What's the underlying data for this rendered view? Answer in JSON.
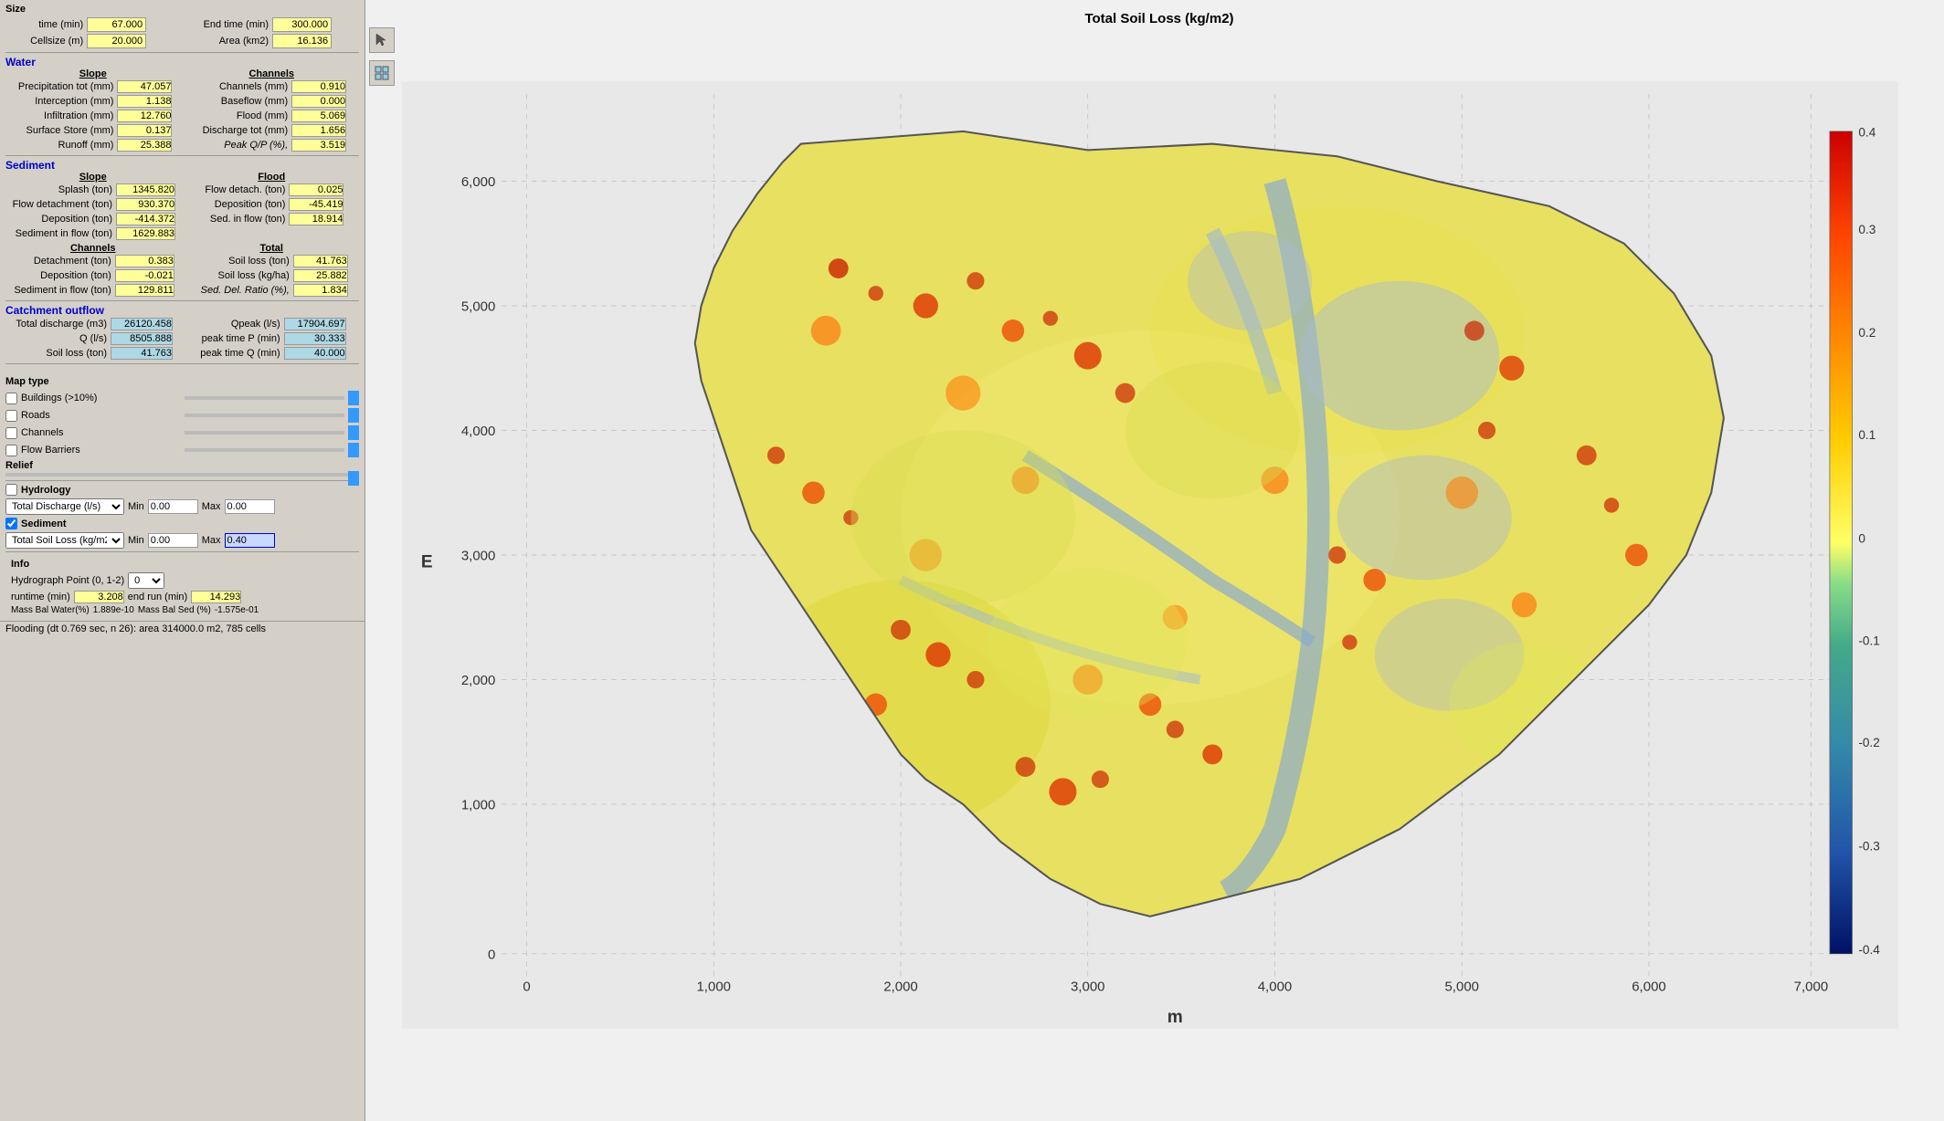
{
  "leftPanel": {
    "size": {
      "title": "Size",
      "time_label": "time (min)",
      "time_val": "67.000",
      "end_time_label": "End time (min)",
      "end_time_val": "300.000",
      "cellsize_label": "Cellsize (m)",
      "cellsize_val": "20.000",
      "area_label": "Area (km2)",
      "area_val": "16.136"
    },
    "water": {
      "title": "Water",
      "slope_header": "Slope",
      "channels_header": "Channels",
      "precip_label": "Precipitation tot (mm)",
      "precip_val": "47.057",
      "channels_mm_label": "Channels (mm)",
      "channels_mm_val": "0.910",
      "interception_label": "Interception (mm)",
      "interception_val": "1.138",
      "baseflow_label": "Baseflow (mm)",
      "baseflow_val": "0.000",
      "infiltration_label": "Infiltration (mm)",
      "infiltration_val": "12.760",
      "flood_label": "Flood (mm)",
      "flood_val": "5.069",
      "surface_label": "Surface Store (mm)",
      "surface_val": "0.137",
      "discharge_label": "Discharge tot (mm)",
      "discharge_val": "1.656",
      "runoff_label": "Runoff (mm)",
      "runoff_val": "25.388",
      "peakqp_label": "Peak Q/P (%),",
      "peakqp_val": "3.519"
    },
    "sediment": {
      "title": "Sediment",
      "slope_header": "Slope",
      "flood_header": "Flood",
      "splash_label": "Splash (ton)",
      "splash_val": "1345.820",
      "flow_detach_flood_label": "Flow detach. (ton)",
      "flow_detach_flood_val": "0.025",
      "flow_detach_label": "Flow detachment (ton)",
      "flow_detach_val": "930.370",
      "deposition_flood_label": "Deposition (ton)",
      "deposition_flood_val": "-45.419",
      "deposition_label": "Deposition (ton)",
      "deposition_val": "-414.372",
      "sed_inflow_flood_label": "Sed. in flow (ton)",
      "sed_inflow_flood_val": "18.914",
      "sed_inflow_label": "Sediment in flow (ton)",
      "sed_inflow_val": "1629.883",
      "channels_header": "Channels",
      "total_header": "Total",
      "detach_label": "Detachment (ton)",
      "detach_val": "0.383",
      "soil_loss_ton_label": "Soil loss (ton)",
      "soil_loss_ton_val": "41.763",
      "dep_label": "Deposition (ton)",
      "dep_val": "-0.021",
      "soil_loss_kgha_label": "Soil loss (kg/ha)",
      "soil_loss_kgha_val": "25.882",
      "sed_ch_label": "Sediment in flow (ton)",
      "sed_ch_val": "129.811",
      "sed_del_label": "Sed. Del. Ratio (%),",
      "sed_del_val": "1.834"
    },
    "catchment": {
      "title": "Catchment outflow",
      "total_discharge_label": "Total discharge (m3)",
      "total_discharge_val": "26120.458",
      "qpeak_label": "Qpeak (l/s)",
      "qpeak_val": "17904.697",
      "q_label": "Q (l/s)",
      "q_val": "8505.888",
      "peak_time_p_label": "peak time P (min)",
      "peak_time_p_val": "30.333",
      "soil_loss_label": "Soil loss (ton)",
      "soil_loss_val": "41.763",
      "peak_time_q_label": "peak time Q (min)",
      "peak_time_q_val": "40.000"
    }
  },
  "mapType": {
    "title": "Map type",
    "buildings_label": "Buildings (>10%)",
    "roads_label": "Roads",
    "channels_label": "Channels",
    "flow_barriers_label": "Flow Barriers",
    "relief_label": "Relief"
  },
  "hydrology": {
    "title": "Hydrology",
    "dropdown_val": "Total Discharge (l/s)",
    "min_label": "Min",
    "max_label": "Max",
    "min_val": "0.00",
    "max_val": "0.00"
  },
  "sediment": {
    "title": "Sediment",
    "dropdown_val": "Total Soil Loss (kg/m2",
    "min_label": "Min",
    "max_label": "Max",
    "min_val": "0.00",
    "max_val": "0.40"
  },
  "info": {
    "title": "Info",
    "hydrograph_label": "Hydrograph Point (0, 1-2)",
    "hydrograph_val": "0",
    "runtime_label": "runtime (min)",
    "runtime_val": "3.208",
    "end_run_label": "end run (min)",
    "end_run_val": "14.293",
    "mass_bal_water_label": "Mass Bal Water(%)",
    "mass_bal_water_val": "1.889e-10",
    "mass_bal_sed_label": "Mass Bal Sed (%)",
    "mass_bal_sed_val": "-1.575e-01"
  },
  "statusBar": {
    "text": "Flooding (dt 0.769 sec, n  26): area 314000.0 m2, 785 cells"
  },
  "map": {
    "title": "Total Soil Loss (kg/m2)",
    "y_label": "E",
    "x_label": "m",
    "scale_values": [
      "0.4",
      "0.3",
      "0.2",
      "0.1",
      "0",
      "-0.1",
      "-0.2",
      "-0.3",
      "-0.4"
    ],
    "y_ticks": [
      "6,000",
      "5,000",
      "4,000",
      "3,000",
      "2,000",
      "1,000",
      "0"
    ],
    "x_ticks": [
      "0",
      "1,000",
      "2,000",
      "3,000",
      "4,000",
      "5,000",
      "6,000",
      "7,000"
    ]
  }
}
